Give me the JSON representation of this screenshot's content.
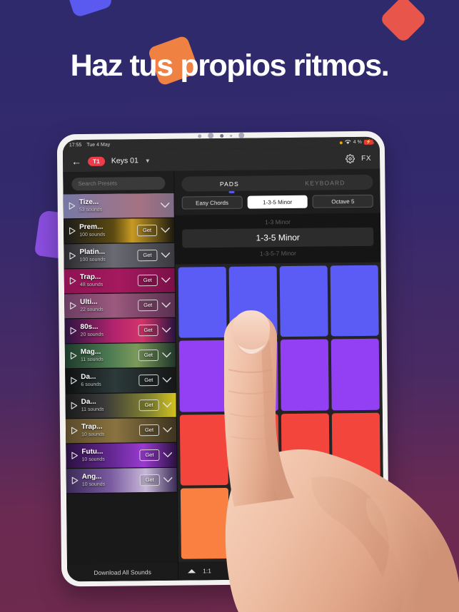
{
  "promo": {
    "headline": "Haz tus propios ritmos.",
    "bg_gradient_top": "#2e2a6b",
    "bg_gradient_bottom": "#6e2a4e",
    "shapes": [
      {
        "name": "blue-square",
        "color": "#5a5af0"
      },
      {
        "name": "red-diamond",
        "color": "#e8554a"
      },
      {
        "name": "orange-square",
        "color": "#ef8143"
      },
      {
        "name": "purple-blob",
        "color": "#8b4fe0"
      }
    ]
  },
  "status_bar": {
    "time": "17:55",
    "date": "Tue 4 May",
    "battery_percent": "4 %",
    "charging": true
  },
  "app_header": {
    "back_icon": "arrow-left-icon",
    "track_badge": "T1",
    "preset_name": "Keys 01",
    "caret_icon": "chevron-down-icon",
    "settings_icon": "gear-icon",
    "fx_label": "FX"
  },
  "pack_panel": {
    "search_placeholder": "Search Presets",
    "download_all_label": "Download All Sounds",
    "packs": [
      {
        "name": "Tize...",
        "count": "53 sounds",
        "has_get": false,
        "art": "tize",
        "selected": true
      },
      {
        "name": "Prem...",
        "count": "100 sounds",
        "has_get": true,
        "art": "premium"
      },
      {
        "name": "Platin...",
        "count": "100 sounds",
        "has_get": true,
        "art": "platinum"
      },
      {
        "name": "Trap...",
        "count": "48 sounds",
        "has_get": true,
        "art": "trap-magenta"
      },
      {
        "name": "Ulti...",
        "count": "22 sounds",
        "has_get": true,
        "art": "rnb"
      },
      {
        "name": "80s...",
        "count": "20 sounds",
        "has_get": true,
        "art": "eighties"
      },
      {
        "name": "Mag...",
        "count": "11 sounds",
        "has_get": true,
        "art": "magic"
      },
      {
        "name": "Da...",
        "count": "6 sounds",
        "has_get": true,
        "art": "damage"
      },
      {
        "name": "Da...",
        "count": "11 sounds",
        "has_get": true,
        "art": "vinyl"
      },
      {
        "name": "Trap...",
        "count": "10 sounds",
        "has_get": true,
        "art": "trap-gold"
      },
      {
        "name": "Futu...",
        "count": "10 sounds",
        "has_get": true,
        "art": "future"
      },
      {
        "name": "Ang...",
        "count": "10 sounds",
        "has_get": true,
        "art": "angel"
      }
    ]
  },
  "main_panel": {
    "mode_tabs": [
      {
        "label": "PADS",
        "active": true
      },
      {
        "label": "KEYBOARD",
        "active": false
      }
    ],
    "chord_buttons": [
      {
        "label": "Easy Chords",
        "style": "dark"
      },
      {
        "label": "1-3-5 Minor",
        "style": "light"
      },
      {
        "label": "Octave 5",
        "style": "dark"
      }
    ],
    "chord_picker": {
      "above": "1-3 Minor",
      "selected": "1-3-5 Minor",
      "below": "1-3-5-7 Minor"
    },
    "pad_colors": {
      "row1": "#5b5bf5",
      "row2": "#9340f5",
      "row3": "#f4453c",
      "row4": "#fa8042"
    },
    "pad_rows": 4,
    "pad_cols": 4
  },
  "transport": {
    "collapse_icon": "chevron-up-icon",
    "tempo_ratio": "1:1",
    "play_icon": "play-icon"
  }
}
